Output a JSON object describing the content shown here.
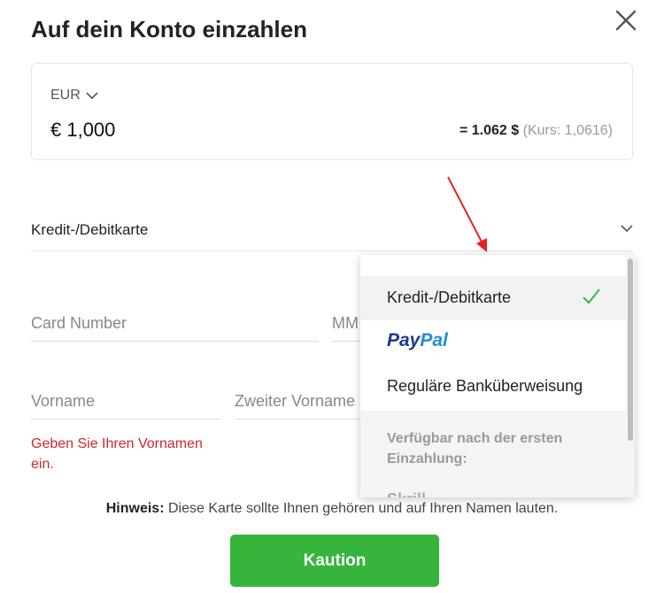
{
  "dialog": {
    "title": "Auf dein Konto einzahlen",
    "close_icon": "close-icon"
  },
  "amount": {
    "currency": "EUR",
    "value": "€ 1,000",
    "converted": "= 1.062 $",
    "rate": "(Kurs: 1,0616)"
  },
  "payment_method": {
    "selected_label": "Kredit-/Debitkarte"
  },
  "fields": {
    "card_number_placeholder": "Card Number",
    "expiry_placeholder": "MM",
    "first_name_placeholder": "Vorname",
    "middle_name_placeholder": "Zweiter Vorname"
  },
  "errors": {
    "first_name": "Geben Sie Ihren Vornamen ein."
  },
  "notice": {
    "bold": "Hinweis:",
    "text": " Diese Karte sollte Ihnen gehören und auf Ihren Namen lauten."
  },
  "submit": {
    "label": "Kaution"
  },
  "dropdown": {
    "items": [
      {
        "label": "Kredit-/Debitkarte",
        "selected": true
      },
      {
        "label_pay": "Pay",
        "label_pal": "Pal"
      },
      {
        "label": "Reguläre Banküberweisung"
      }
    ],
    "section_label": "Verfügbar nach der ersten Einzahlung:",
    "cut_item": "Skrill"
  },
  "colors": {
    "accent_green": "#36b43c",
    "error_red": "#d0262f",
    "check_green": "#3bb34a",
    "annotation_red": "#e8231f"
  }
}
